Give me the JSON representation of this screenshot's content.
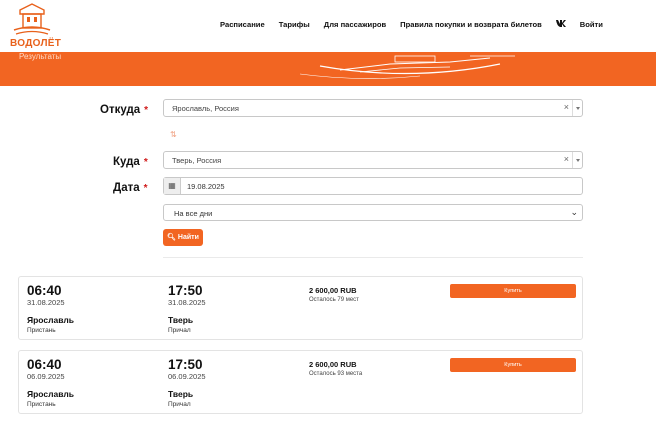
{
  "brand": {
    "logo_text": "ВОДОЛЁТ",
    "accent_color": "#f26522"
  },
  "nav": {
    "items": [
      "Расписание",
      "Тарифы",
      "Для пассажиров",
      "Правила покупки и возврата билетов"
    ],
    "vk_icon": "vk-icon",
    "login": "Войти"
  },
  "band": {
    "subtitle": "Результаты"
  },
  "form": {
    "from_label": "Откуда",
    "from_value": "Ярославль, Россия",
    "to_label": "Куда",
    "to_value": "Тверь, Россия",
    "date_label": "Дата",
    "date_value": "19.08.2025",
    "required_mark": "*",
    "days_value": "На все дни",
    "find_label": "Найти"
  },
  "results": [
    {
      "depart_time": "06:40",
      "depart_date": "31.08.2025",
      "arrive_time": "17:50",
      "arrive_date": "31.08.2025",
      "from_city": "Ярославль",
      "from_place": "Пристань",
      "to_city": "Тверь",
      "to_place": "Причал",
      "price": "2 600,00 RUB",
      "seats_left": "Осталось 79 мест",
      "buy_label": "Купить"
    },
    {
      "depart_time": "06:40",
      "depart_date": "06.09.2025",
      "arrive_time": "17:50",
      "arrive_date": "06.09.2025",
      "from_city": "Ярославль",
      "from_place": "Пристань",
      "to_city": "Тверь",
      "to_place": "Причал",
      "price": "2 600,00 RUB",
      "seats_left": "Осталось 93 места",
      "buy_label": "Купить"
    }
  ]
}
